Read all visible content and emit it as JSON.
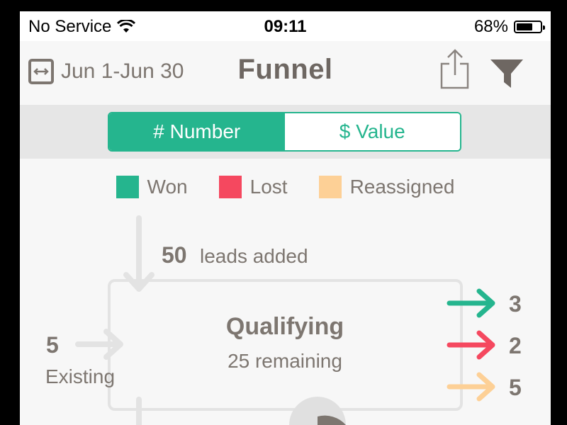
{
  "status_bar": {
    "carrier": "No Service",
    "time": "09:11",
    "battery_percent_label": "68%",
    "battery_level": 0.68
  },
  "nav": {
    "date_range": "Jun 1-Jun 30",
    "title": "Funnel",
    "icons": {
      "calendar": "calendar-range-icon",
      "share": "share-icon",
      "filter": "filter-icon"
    }
  },
  "segmented_control": {
    "options": [
      "# Number",
      "$ Value"
    ],
    "selected": "# Number"
  },
  "legend": [
    {
      "label": "Won",
      "color": "#25b58e"
    },
    {
      "label": "Lost",
      "color": "#f5485f"
    },
    {
      "label": "Reassigned",
      "color": "#fdd096"
    }
  ],
  "funnel": {
    "leads_added_count": "50",
    "leads_added_label": "leads added",
    "existing_count": "5",
    "existing_label": "Existing",
    "stage_title": "Qualifying",
    "stage_subtitle": "25 remaining",
    "outcomes": [
      {
        "count": "3",
        "color": "#25b58e"
      },
      {
        "count": "2",
        "color": "#f5485f"
      },
      {
        "count": "5",
        "color": "#fdd096"
      }
    ]
  },
  "colors": {
    "accent": "#25b58e",
    "text_gray": "#7d7670",
    "arrow_gray": "#e3e3e3"
  }
}
